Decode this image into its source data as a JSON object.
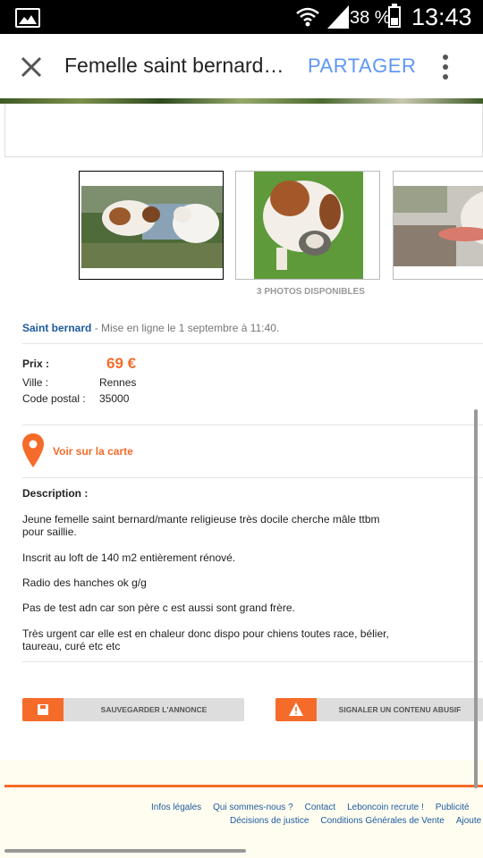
{
  "status_bar": {
    "battery": "38 %",
    "battery_level": 0.38,
    "time": "13:43",
    "icons": [
      "gallery-icon",
      "wifi-icon",
      "signal-icon",
      "battery-icon"
    ]
  },
  "app_bar": {
    "title": "Femelle saint bernard…",
    "share_label": "PARTAGER",
    "icons": [
      "close-icon",
      "more-vertical-icon"
    ]
  },
  "gallery": {
    "photos_count_label": "3 PHOTOS DISPONIBLES"
  },
  "listing": {
    "category": "Saint bernard",
    "posted": " - Mise en ligne le 1 septembre à 11:40.",
    "price_label": "Prix :",
    "price": "69 €",
    "city_label": "Ville :",
    "city": "Rennes",
    "postal_label": "Code postal :",
    "postal": "35000",
    "map_link": "Voir sur la carte",
    "description_title": "Description :",
    "description": [
      "Jeune femelle saint bernard/mante religieuse très docile cherche mâle ttbm pour saillie.",
      "Inscrit au loft de 140 m2 entièrement rénové.",
      "Radio des hanches ok g/g",
      "Pas de test adn car son père c est aussi sont grand frère.",
      "Très urgent car elle est en chaleur donc dispo pour chiens toutes race, bélier, taureau, curé etc etc"
    ]
  },
  "actions": {
    "save_label": "SAUVEGARDER L'ANNONCE",
    "report_label": "SIGNALER UN CONTENU ABUSIF"
  },
  "footer": {
    "row1": [
      "Infos légales",
      "Qui sommes-nous ?",
      "Contact",
      "Leboncoin recrute !",
      "Publicité"
    ],
    "row2": [
      "Décisions de justice",
      "Conditions Générales de Vente",
      "Ajoute"
    ]
  },
  "colors": {
    "accent": "#f56b2a",
    "link": "#1c5a9e",
    "share": "#5e97f6"
  }
}
